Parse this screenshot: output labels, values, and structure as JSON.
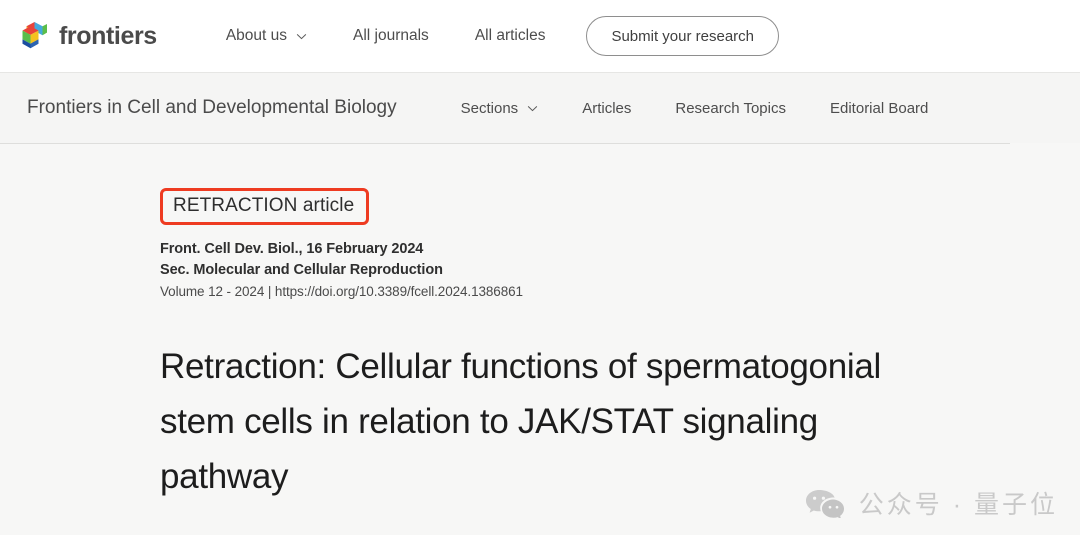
{
  "header": {
    "brand_name": "frontiers",
    "logo_icon": "frontiers-cube-logo",
    "nav": [
      {
        "label": "About us",
        "has_dropdown": true,
        "icon": "chevron-down-icon"
      },
      {
        "label": "All journals",
        "has_dropdown": false
      },
      {
        "label": "All articles",
        "has_dropdown": false
      }
    ],
    "submit_button": "Submit your research"
  },
  "journal_bar": {
    "title": "Frontiers in Cell and Developmental Biology",
    "nav": [
      {
        "label": "Sections",
        "has_dropdown": true,
        "icon": "chevron-down-icon"
      },
      {
        "label": "Articles",
        "has_dropdown": false
      },
      {
        "label": "Research Topics",
        "has_dropdown": false
      },
      {
        "label": "Editorial Board",
        "has_dropdown": false
      }
    ]
  },
  "article": {
    "badge_label": "RETRACTION article",
    "badge_highlight_color": "#ee3b21",
    "journal_line": "Front. Cell Dev. Biol., 16 February 2024",
    "section_line": "Sec. Molecular and Cellular Reproduction",
    "volume_line": "Volume 12 - 2024 | https://doi.org/10.3389/fcell.2024.1386861",
    "title": "Retraction: Cellular functions of spermatogonial stem cells in relation to JAK/STAT signaling pathway"
  },
  "watermark": {
    "icon": "wechat-icon",
    "text": "公众号 · 量子位",
    "color": "#c9c9c9"
  }
}
